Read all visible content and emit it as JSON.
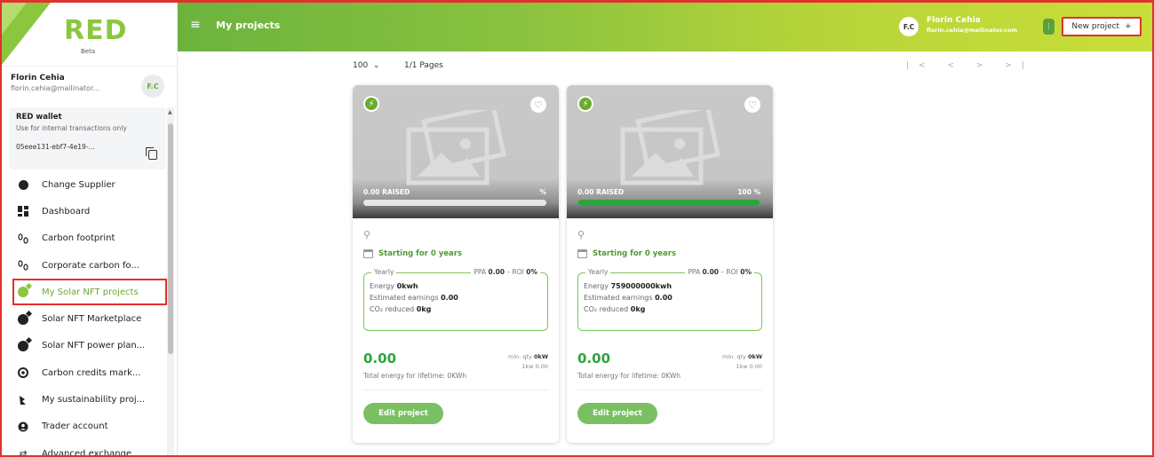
{
  "app": {
    "logo_text": "RED",
    "logo_badge": "Beta",
    "accent_color": "#6aaa2f",
    "header_gradient": [
      "#6cb33e",
      "#c9de38"
    ]
  },
  "sidebar": {
    "user": {
      "name": "Florin Cehia",
      "email": "florin.cehia@mailinator...",
      "initials": "F.C"
    },
    "wallet": {
      "title": "RED wallet",
      "description": "Use for internal transactions only",
      "id": "05eee131-ebf7-4e19-..."
    },
    "items": [
      {
        "label": "Change Supplier",
        "icon": "change-supplier-icon"
      },
      {
        "label": "Dashboard",
        "icon": "dashboard-icon"
      },
      {
        "label": "Carbon footprint",
        "icon": "footprint-icon"
      },
      {
        "label": "Corporate carbon fo...",
        "icon": "footprint-icon"
      },
      {
        "label": "My Solar NFT projects",
        "icon": "nft-icon",
        "active": true
      },
      {
        "label": "Solar NFT Marketplace",
        "icon": "nft-icon"
      },
      {
        "label": "Solar NFT power plan...",
        "icon": "nft-icon"
      },
      {
        "label": "Carbon credits mark...",
        "icon": "carbon-credits-icon"
      },
      {
        "label": "My sustainability proj...",
        "icon": "sustainability-icon"
      },
      {
        "label": "Trader account",
        "icon": "trader-icon"
      },
      {
        "label": "Advanced exchange",
        "icon": "exchange-icon"
      }
    ]
  },
  "header": {
    "menu_icon": "≡",
    "title": "My projects",
    "user_initials": "F.C",
    "user_name": "Florin Cehia",
    "user_email": "florin.cehia@mailinator.com",
    "new_project_label": "New project",
    "new_project_icon": "+"
  },
  "pagination": {
    "page_size": "100",
    "pages": "1/1 Pages",
    "nav": "|< < > >|"
  },
  "cards": [
    {
      "raised": "0.00 RAISED",
      "raised_pct": "%",
      "progress": 0,
      "starting": "Starting for 0 years",
      "yearly": "Yearly",
      "ppa_prefix": "PPA",
      "ppa_value": "0.00",
      "roi_prefix": "ROI",
      "roi_value": "0%",
      "energy_label": "Energy",
      "energy_value": "0kwh",
      "earnings_label": "Estimated earnings",
      "earnings_value": "0.00",
      "co2_label": "CO₂ reduced",
      "co2_value": "0kg",
      "price": "0.00",
      "min_qty_label": "min. qty",
      "min_qty_value": "0kW",
      "kw_label": "1kw",
      "kw_value": "0.00",
      "total_energy": "Total energy for lifetime: 0KWh",
      "edit_label": "Edit project"
    },
    {
      "raised": "0.00 RAISED",
      "raised_pct": "100 %",
      "progress": 100,
      "starting": "Starting for 0 years",
      "yearly": "Yearly",
      "ppa_prefix": "PPA",
      "ppa_value": "0.00",
      "roi_prefix": "ROI",
      "roi_value": "0%",
      "energy_label": "Energy",
      "energy_value": "759000000kwh",
      "earnings_label": "Estimated earnings",
      "earnings_value": "0.00",
      "co2_label": "CO₂ reduced",
      "co2_value": "0kg",
      "price": "0.00",
      "min_qty_label": "min. qty",
      "min_qty_value": "0kW",
      "kw_label": "1kw",
      "kw_value": "0.00",
      "total_energy": "Total energy for lifetime: 0KWh",
      "edit_label": "Edit project"
    }
  ]
}
